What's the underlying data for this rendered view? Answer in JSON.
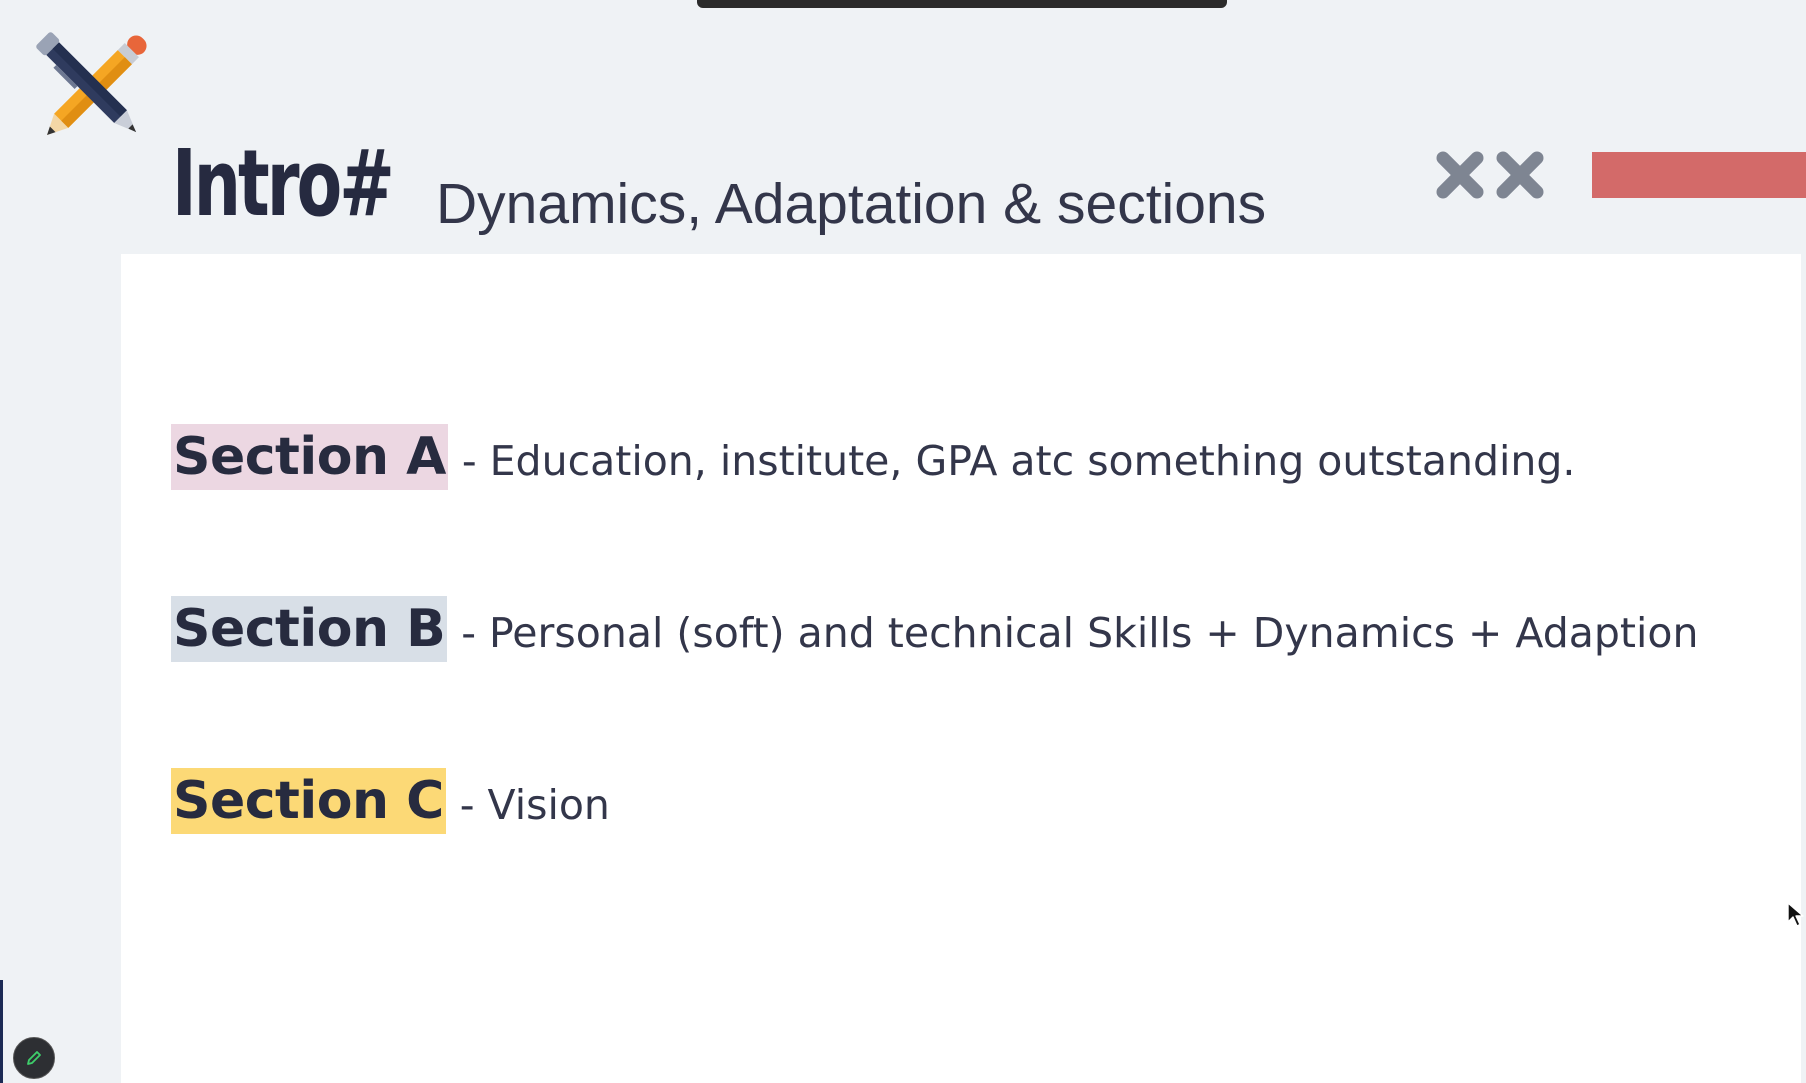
{
  "slide": {
    "title": "Intro#",
    "subtitle": "Dynamics, Adaptation & sections",
    "logo_icon": "pencil-pen-crossed-icon",
    "decoration_icons": [
      "x-mark-icon",
      "x-mark-icon"
    ],
    "accent_color": "#d36a69",
    "sections": [
      {
        "label": "Section A",
        "description": "- Education, institute, GPA atc something outstanding.",
        "highlight_color": "#ecd7e2"
      },
      {
        "label": "Section B",
        "description": "- Personal (soft) and technical Skills + Dynamics + Adaption",
        "highlight_color": "#d8dfe7"
      },
      {
        "label": "Section C",
        "description": "- Vision",
        "highlight_color": "#fcd976"
      }
    ]
  },
  "overlay": {
    "edit_button_icon": "pencil-icon",
    "cursor_icon": "mouse-pointer-icon"
  }
}
